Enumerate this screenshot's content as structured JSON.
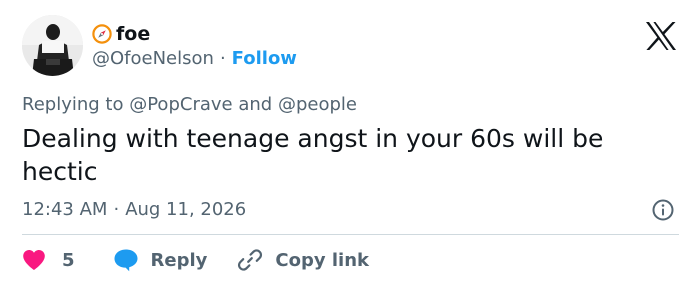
{
  "tweet": {
    "display_name": "foe",
    "handle": "@OfoeNelson",
    "separator": "·",
    "follow_label": "Follow",
    "replying_prefix": "Replying to",
    "replying_user_1": "@PopCrave",
    "replying_conjunction": "and",
    "replying_user_2": "@people",
    "text": "Dealing with teenage angst in your 60s will be hectic",
    "time": "12:43 AM",
    "date": "Aug 11, 2026"
  },
  "actions": {
    "like_count": "5",
    "reply_label": "Reply",
    "copy_link_label": "Copy link"
  },
  "colors": {
    "text_primary": "#0f1419",
    "text_secondary": "#536471",
    "accent_blue": "#1d9bf0",
    "like_pink": "#f91880",
    "divider": "#cfd9de",
    "compass_orange": "#f4900c"
  },
  "icons": {
    "badge": "compass-icon",
    "brand": "x-logo-icon",
    "info": "info-icon",
    "like": "heart-icon",
    "reply": "speech-bubble-icon",
    "copy": "link-icon"
  }
}
